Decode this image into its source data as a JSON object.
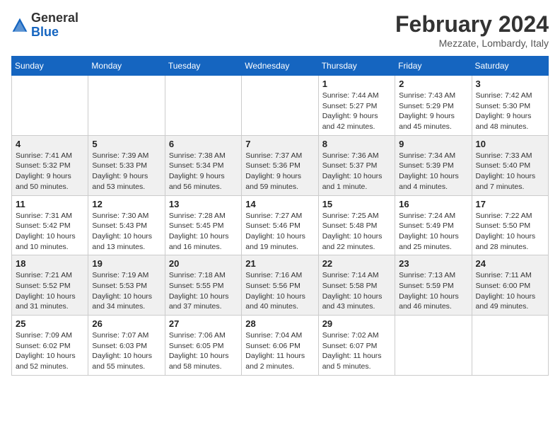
{
  "header": {
    "logo_general": "General",
    "logo_blue": "Blue",
    "month_title": "February 2024",
    "location": "Mezzate, Lombardy, Italy"
  },
  "days_of_week": [
    "Sunday",
    "Monday",
    "Tuesday",
    "Wednesday",
    "Thursday",
    "Friday",
    "Saturday"
  ],
  "weeks": [
    [
      {
        "day": "",
        "info": ""
      },
      {
        "day": "",
        "info": ""
      },
      {
        "day": "",
        "info": ""
      },
      {
        "day": "",
        "info": ""
      },
      {
        "day": "1",
        "info": "Sunrise: 7:44 AM\nSunset: 5:27 PM\nDaylight: 9 hours\nand 42 minutes."
      },
      {
        "day": "2",
        "info": "Sunrise: 7:43 AM\nSunset: 5:29 PM\nDaylight: 9 hours\nand 45 minutes."
      },
      {
        "day": "3",
        "info": "Sunrise: 7:42 AM\nSunset: 5:30 PM\nDaylight: 9 hours\nand 48 minutes."
      }
    ],
    [
      {
        "day": "4",
        "info": "Sunrise: 7:41 AM\nSunset: 5:32 PM\nDaylight: 9 hours\nand 50 minutes."
      },
      {
        "day": "5",
        "info": "Sunrise: 7:39 AM\nSunset: 5:33 PM\nDaylight: 9 hours\nand 53 minutes."
      },
      {
        "day": "6",
        "info": "Sunrise: 7:38 AM\nSunset: 5:34 PM\nDaylight: 9 hours\nand 56 minutes."
      },
      {
        "day": "7",
        "info": "Sunrise: 7:37 AM\nSunset: 5:36 PM\nDaylight: 9 hours\nand 59 minutes."
      },
      {
        "day": "8",
        "info": "Sunrise: 7:36 AM\nSunset: 5:37 PM\nDaylight: 10 hours\nand 1 minute."
      },
      {
        "day": "9",
        "info": "Sunrise: 7:34 AM\nSunset: 5:39 PM\nDaylight: 10 hours\nand 4 minutes."
      },
      {
        "day": "10",
        "info": "Sunrise: 7:33 AM\nSunset: 5:40 PM\nDaylight: 10 hours\nand 7 minutes."
      }
    ],
    [
      {
        "day": "11",
        "info": "Sunrise: 7:31 AM\nSunset: 5:42 PM\nDaylight: 10 hours\nand 10 minutes."
      },
      {
        "day": "12",
        "info": "Sunrise: 7:30 AM\nSunset: 5:43 PM\nDaylight: 10 hours\nand 13 minutes."
      },
      {
        "day": "13",
        "info": "Sunrise: 7:28 AM\nSunset: 5:45 PM\nDaylight: 10 hours\nand 16 minutes."
      },
      {
        "day": "14",
        "info": "Sunrise: 7:27 AM\nSunset: 5:46 PM\nDaylight: 10 hours\nand 19 minutes."
      },
      {
        "day": "15",
        "info": "Sunrise: 7:25 AM\nSunset: 5:48 PM\nDaylight: 10 hours\nand 22 minutes."
      },
      {
        "day": "16",
        "info": "Sunrise: 7:24 AM\nSunset: 5:49 PM\nDaylight: 10 hours\nand 25 minutes."
      },
      {
        "day": "17",
        "info": "Sunrise: 7:22 AM\nSunset: 5:50 PM\nDaylight: 10 hours\nand 28 minutes."
      }
    ],
    [
      {
        "day": "18",
        "info": "Sunrise: 7:21 AM\nSunset: 5:52 PM\nDaylight: 10 hours\nand 31 minutes."
      },
      {
        "day": "19",
        "info": "Sunrise: 7:19 AM\nSunset: 5:53 PM\nDaylight: 10 hours\nand 34 minutes."
      },
      {
        "day": "20",
        "info": "Sunrise: 7:18 AM\nSunset: 5:55 PM\nDaylight: 10 hours\nand 37 minutes."
      },
      {
        "day": "21",
        "info": "Sunrise: 7:16 AM\nSunset: 5:56 PM\nDaylight: 10 hours\nand 40 minutes."
      },
      {
        "day": "22",
        "info": "Sunrise: 7:14 AM\nSunset: 5:58 PM\nDaylight: 10 hours\nand 43 minutes."
      },
      {
        "day": "23",
        "info": "Sunrise: 7:13 AM\nSunset: 5:59 PM\nDaylight: 10 hours\nand 46 minutes."
      },
      {
        "day": "24",
        "info": "Sunrise: 7:11 AM\nSunset: 6:00 PM\nDaylight: 10 hours\nand 49 minutes."
      }
    ],
    [
      {
        "day": "25",
        "info": "Sunrise: 7:09 AM\nSunset: 6:02 PM\nDaylight: 10 hours\nand 52 minutes."
      },
      {
        "day": "26",
        "info": "Sunrise: 7:07 AM\nSunset: 6:03 PM\nDaylight: 10 hours\nand 55 minutes."
      },
      {
        "day": "27",
        "info": "Sunrise: 7:06 AM\nSunset: 6:05 PM\nDaylight: 10 hours\nand 58 minutes."
      },
      {
        "day": "28",
        "info": "Sunrise: 7:04 AM\nSunset: 6:06 PM\nDaylight: 11 hours\nand 2 minutes."
      },
      {
        "day": "29",
        "info": "Sunrise: 7:02 AM\nSunset: 6:07 PM\nDaylight: 11 hours\nand 5 minutes."
      },
      {
        "day": "",
        "info": ""
      },
      {
        "day": "",
        "info": ""
      }
    ]
  ]
}
